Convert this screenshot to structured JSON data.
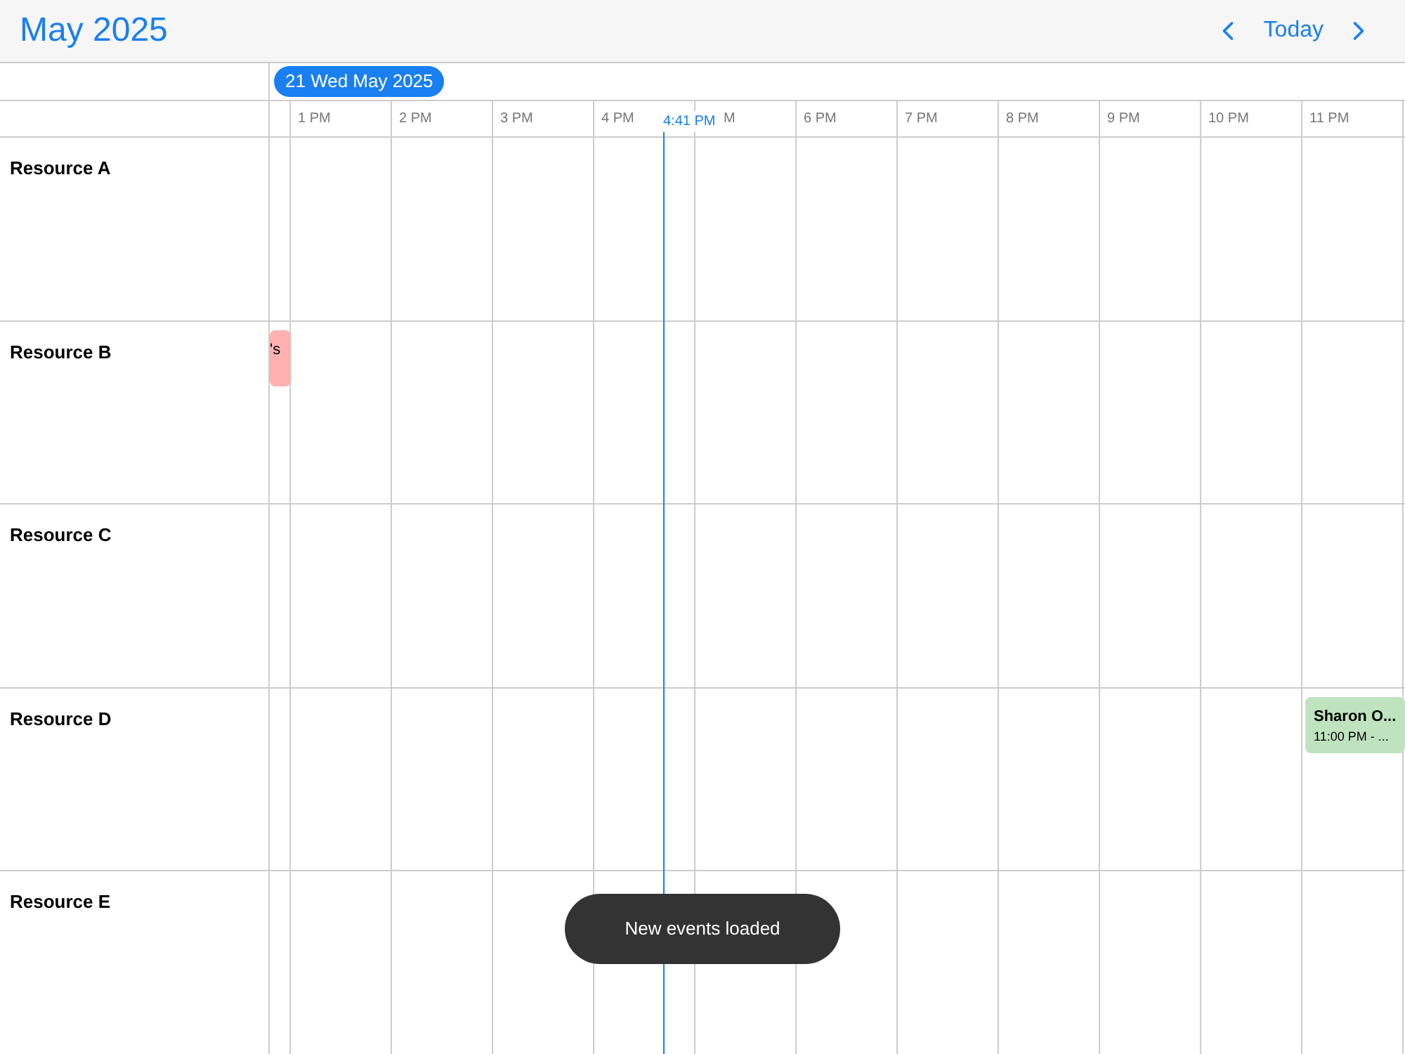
{
  "header": {
    "title": "May 2025",
    "today_button": "Today"
  },
  "date_pill": "21 Wed May 2025",
  "hours": [
    {
      "label": "1 PM"
    },
    {
      "label": "2 PM"
    },
    {
      "label": "3 PM"
    },
    {
      "label": "4 PM"
    },
    {
      "label": "M"
    },
    {
      "label": "6 PM"
    },
    {
      "label": "7 PM"
    },
    {
      "label": "8 PM"
    },
    {
      "label": "9 PM"
    },
    {
      "label": "10 PM"
    },
    {
      "label": "11 PM"
    }
  ],
  "now_marker": "4:41 PM",
  "resources": [
    {
      "name": "Resource A"
    },
    {
      "name": "Resource B",
      "events": [
        {
          "title": "'s",
          "color": "#ffb1b1"
        }
      ]
    },
    {
      "name": "Resource C"
    },
    {
      "name": "Resource D",
      "events": [
        {
          "title": "Sharon O...",
          "time": "11:00 PM - ...",
          "color": "#bfe3bf"
        }
      ]
    },
    {
      "name": "Resource E"
    }
  ],
  "toast": "New events loaded"
}
